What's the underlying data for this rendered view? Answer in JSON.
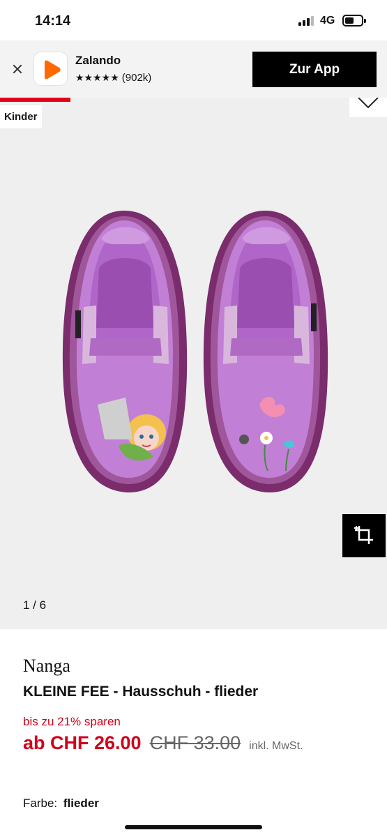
{
  "status_bar": {
    "time": "14:14",
    "network": "4G"
  },
  "app_banner": {
    "app_name": "Zalando",
    "stars": "★★★★★",
    "rating_count": "(902k)",
    "cta_label": "Zur App",
    "brand_color": "#ff6900"
  },
  "gallery": {
    "badge": "Kinder",
    "pager": "1 / 6",
    "accent_color": "#e4001b"
  },
  "product": {
    "brand": "Nanga",
    "name": "KLEINE FEE - Hausschuh - flieder",
    "savings": "bis zu 21% sparen",
    "price_current": "ab CHF 26.00",
    "price_old": "CHF 33.00",
    "tax_note": "inkl. MwSt.",
    "color_label": "Farbe:",
    "color_value": "flieder"
  }
}
